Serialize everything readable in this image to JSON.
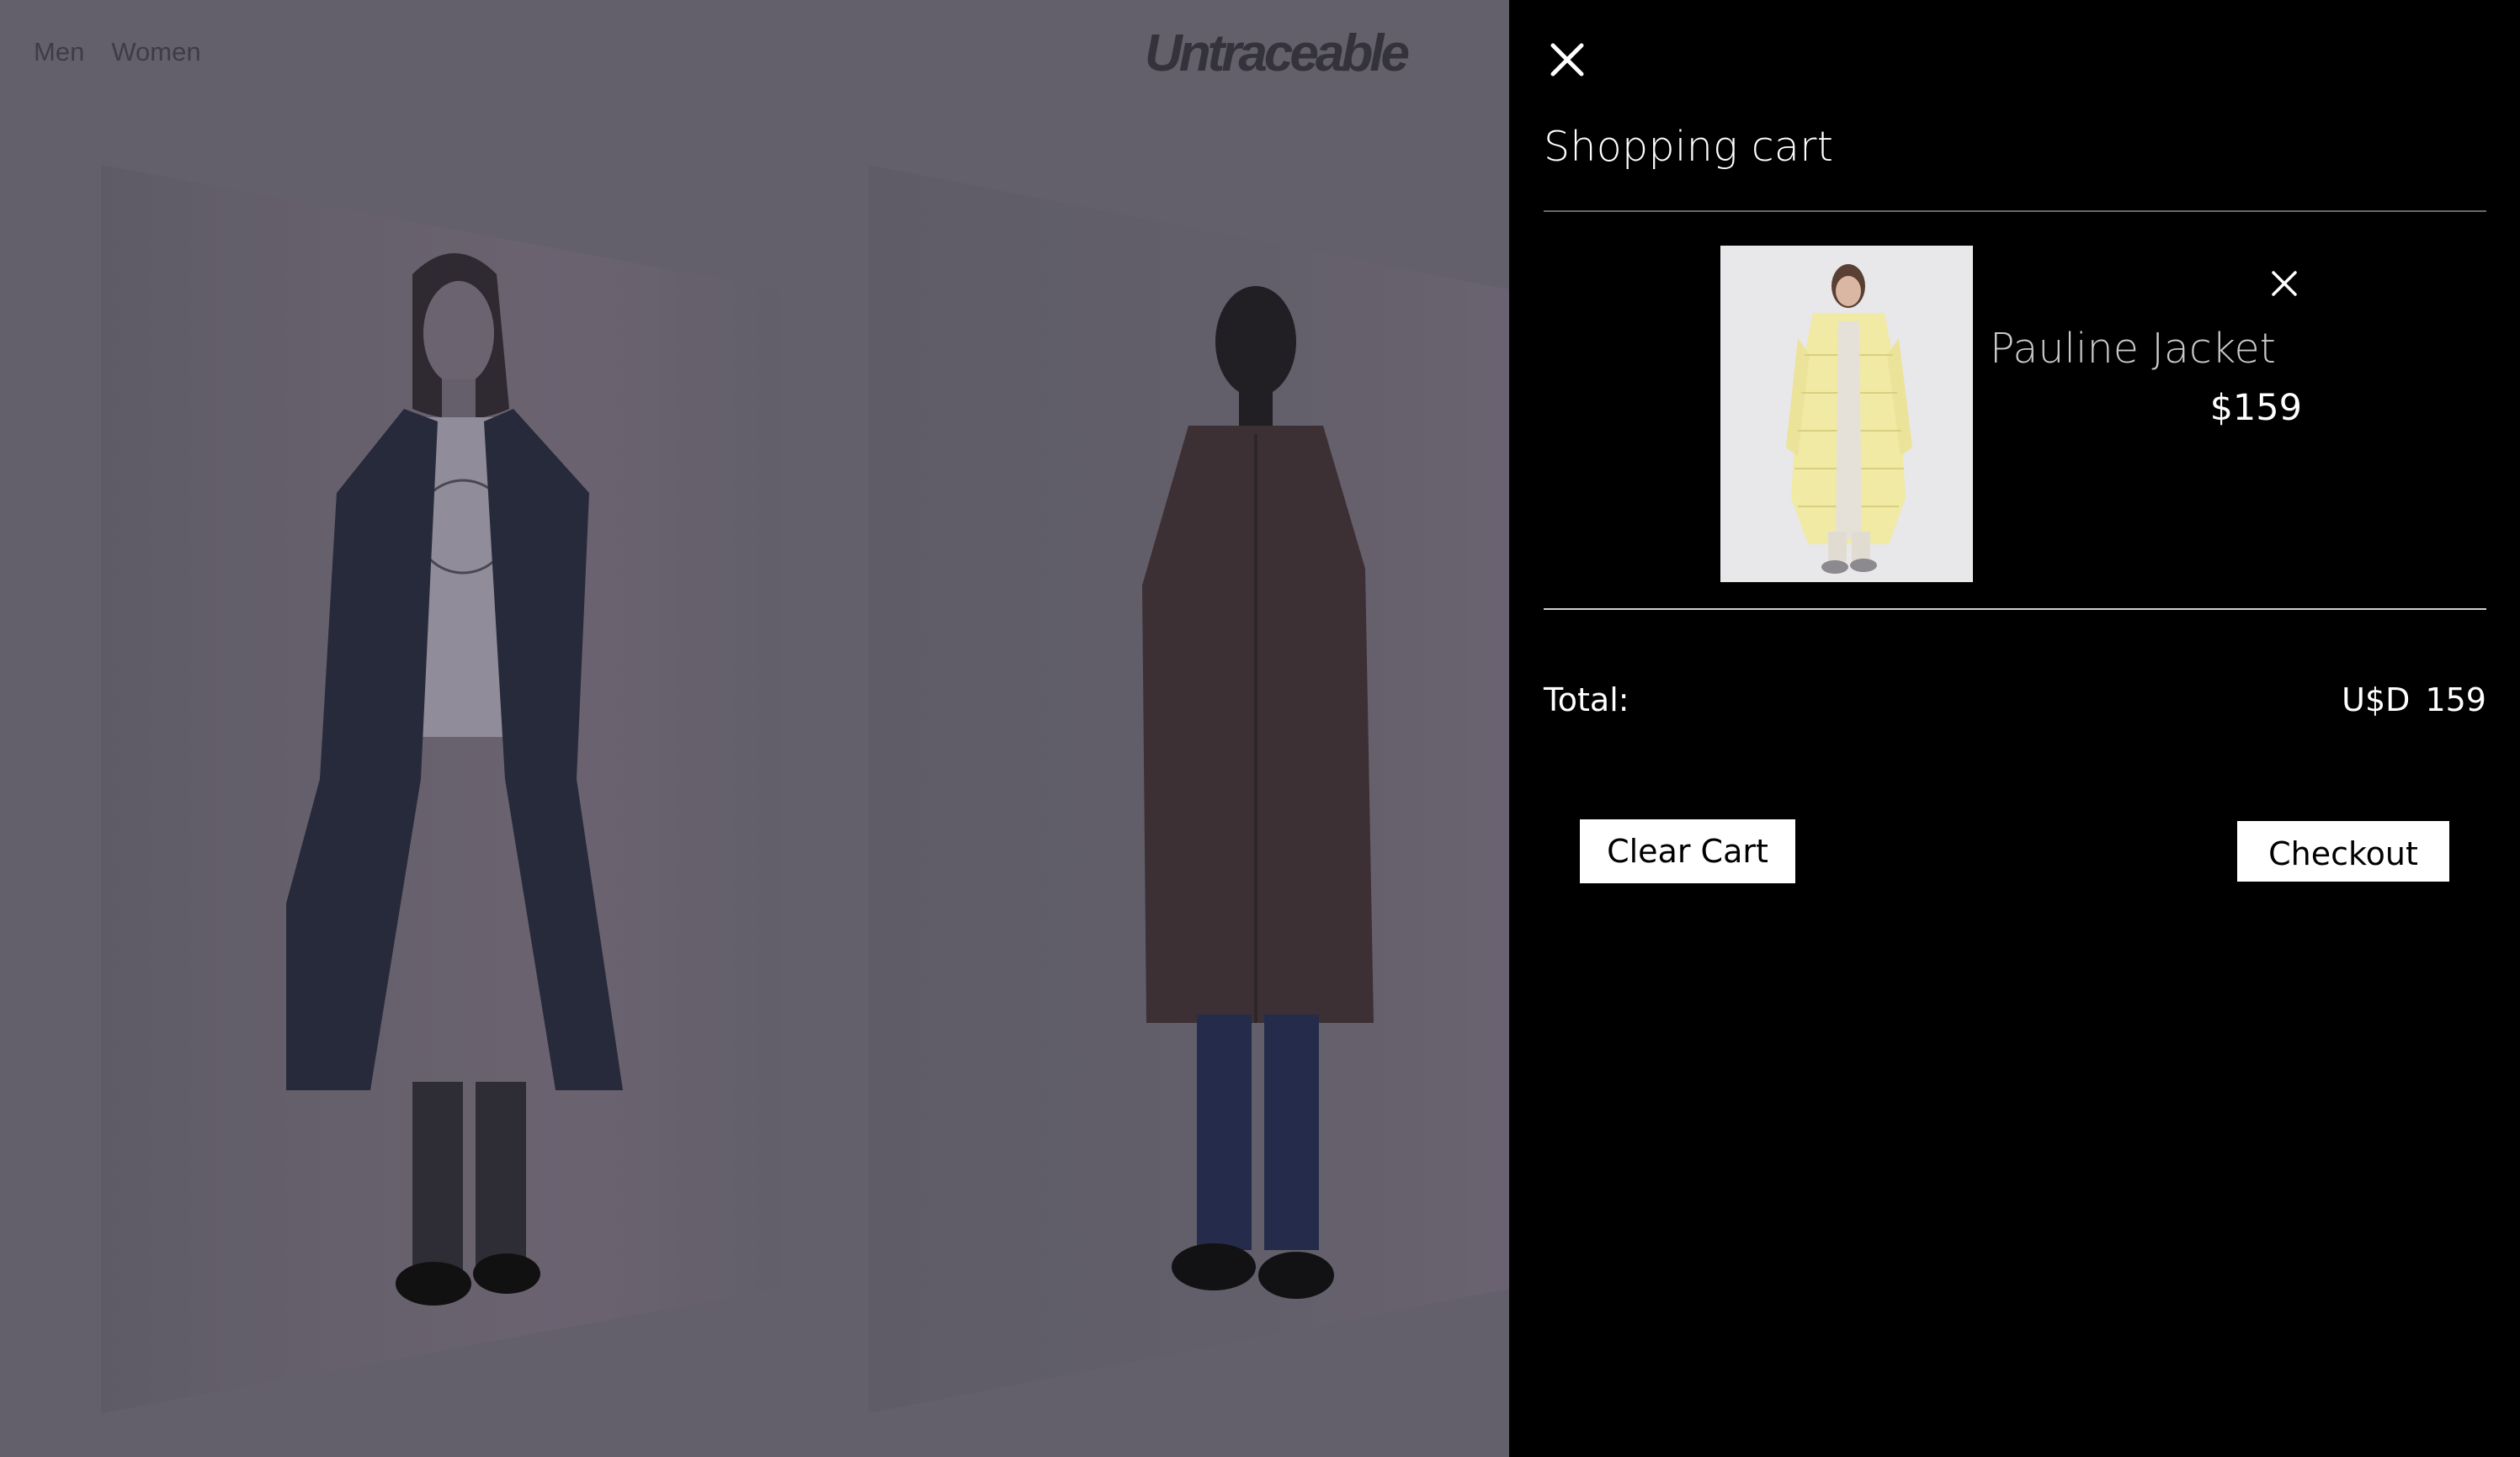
{
  "store": {
    "nav": [
      {
        "label": "Men"
      },
      {
        "label": "Women"
      }
    ],
    "logo": "Untraceable"
  },
  "cart": {
    "title": "Shopping cart",
    "close_icon": "close-icon",
    "items": [
      {
        "name": "Pauline Jacket",
        "price": "$159",
        "remove_icon": "close-icon"
      }
    ],
    "total_label": "Total:",
    "total_value": "U$D 159",
    "clear_label": "Clear Cart",
    "checkout_label": "Checkout"
  },
  "colors": {
    "cart_background": "#000000",
    "overlay": "#63606c",
    "button_background": "#ffffff"
  }
}
